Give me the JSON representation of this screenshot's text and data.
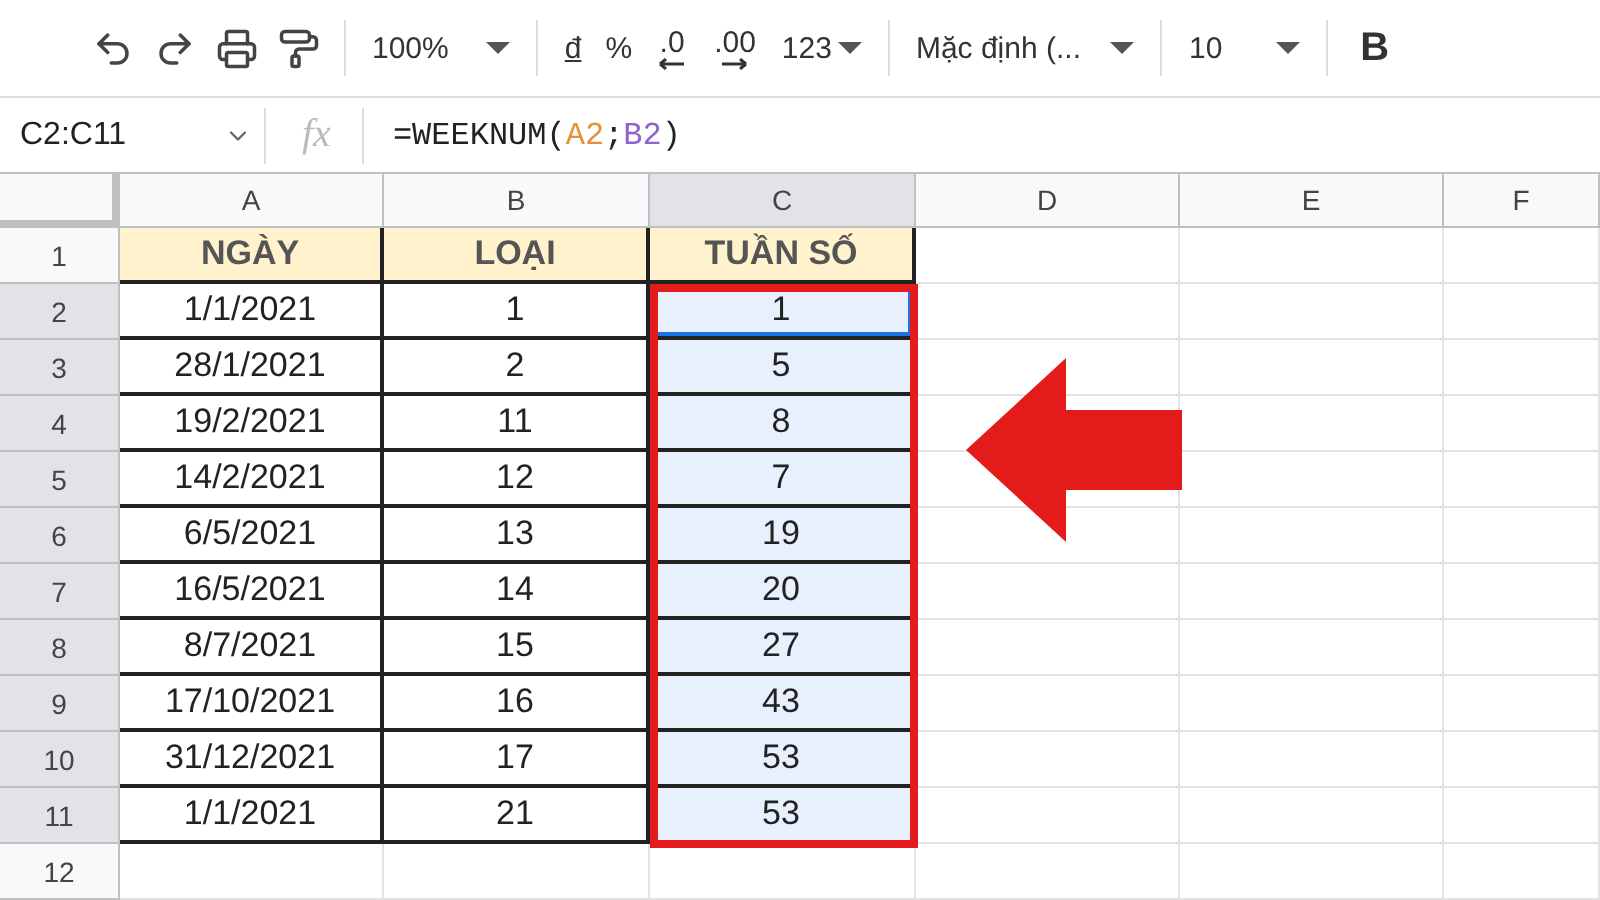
{
  "toolbar": {
    "zoom": "100%",
    "currency": "đ",
    "percent": "%",
    "decrease_decimals": ".0",
    "increase_decimals": ".00",
    "more_formats": "123",
    "font": "Mặc định (...",
    "font_size": "10",
    "bold": "B"
  },
  "formula_bar": {
    "name_box": "C2:C11",
    "function_label": "fx",
    "formula": [
      {
        "text": "=WEEKNUM(",
        "kind": "text"
      },
      {
        "text": "A2",
        "kind": "ref",
        "color": "#e69138"
      },
      {
        "text": ";",
        "kind": "text"
      },
      {
        "text": "B2",
        "kind": "ref",
        "color": "#8e63ce"
      },
      {
        "text": ")",
        "kind": "text"
      }
    ]
  },
  "columns": [
    {
      "label": "A",
      "selected": false
    },
    {
      "label": "B",
      "selected": false
    },
    {
      "label": "C",
      "selected": true
    },
    {
      "label": "D",
      "selected": false
    },
    {
      "label": "E",
      "selected": false
    },
    {
      "label": "F",
      "selected": false
    }
  ],
  "rows": [
    {
      "number": "1",
      "kind": "header",
      "selected": false,
      "cells": [
        {
          "text": "NGÀY",
          "selected": false,
          "active": false
        },
        {
          "text": "LOẠI",
          "selected": false,
          "active": false
        },
        {
          "text": "TUẦN SỐ",
          "selected": false,
          "active": false
        }
      ]
    },
    {
      "number": "2",
      "kind": "data",
      "selected": true,
      "cells": [
        {
          "text": "1/1/2021",
          "selected": false,
          "active": false
        },
        {
          "text": "1",
          "selected": false,
          "active": false
        },
        {
          "text": "1",
          "selected": true,
          "active": true
        }
      ]
    },
    {
      "number": "3",
      "kind": "data",
      "selected": true,
      "cells": [
        {
          "text": "28/1/2021",
          "selected": false,
          "active": false
        },
        {
          "text": "2",
          "selected": false,
          "active": false
        },
        {
          "text": "5",
          "selected": true,
          "active": false
        }
      ]
    },
    {
      "number": "4",
      "kind": "data",
      "selected": true,
      "cells": [
        {
          "text": "19/2/2021",
          "selected": false,
          "active": false
        },
        {
          "text": "11",
          "selected": false,
          "active": false
        },
        {
          "text": "8",
          "selected": true,
          "active": false
        }
      ]
    },
    {
      "number": "5",
      "kind": "data",
      "selected": true,
      "cells": [
        {
          "text": "14/2/2021",
          "selected": false,
          "active": false
        },
        {
          "text": "12",
          "selected": false,
          "active": false
        },
        {
          "text": "7",
          "selected": true,
          "active": false
        }
      ]
    },
    {
      "number": "6",
      "kind": "data",
      "selected": true,
      "cells": [
        {
          "text": "6/5/2021",
          "selected": false,
          "active": false
        },
        {
          "text": "13",
          "selected": false,
          "active": false
        },
        {
          "text": "19",
          "selected": true,
          "active": false
        }
      ]
    },
    {
      "number": "7",
      "kind": "data",
      "selected": true,
      "cells": [
        {
          "text": "16/5/2021",
          "selected": false,
          "active": false
        },
        {
          "text": "14",
          "selected": false,
          "active": false
        },
        {
          "text": "20",
          "selected": true,
          "active": false
        }
      ]
    },
    {
      "number": "8",
      "kind": "data",
      "selected": true,
      "cells": [
        {
          "text": "8/7/2021",
          "selected": false,
          "active": false
        },
        {
          "text": "15",
          "selected": false,
          "active": false
        },
        {
          "text": "27",
          "selected": true,
          "active": false
        }
      ]
    },
    {
      "number": "9",
      "kind": "data",
      "selected": true,
      "cells": [
        {
          "text": "17/10/2021",
          "selected": false,
          "active": false
        },
        {
          "text": "16",
          "selected": false,
          "active": false
        },
        {
          "text": "43",
          "selected": true,
          "active": false
        }
      ]
    },
    {
      "number": "10",
      "kind": "data",
      "selected": true,
      "cells": [
        {
          "text": "31/12/2021",
          "selected": false,
          "active": false
        },
        {
          "text": "17",
          "selected": false,
          "active": false
        },
        {
          "text": "53",
          "selected": true,
          "active": false
        }
      ]
    },
    {
      "number": "11",
      "kind": "data",
      "selected": true,
      "cells": [
        {
          "text": "1/1/2021",
          "selected": false,
          "active": false
        },
        {
          "text": "21",
          "selected": false,
          "active": false
        },
        {
          "text": "53",
          "selected": true,
          "active": false
        }
      ]
    },
    {
      "number": "12",
      "kind": "empty",
      "selected": false
    }
  ]
}
